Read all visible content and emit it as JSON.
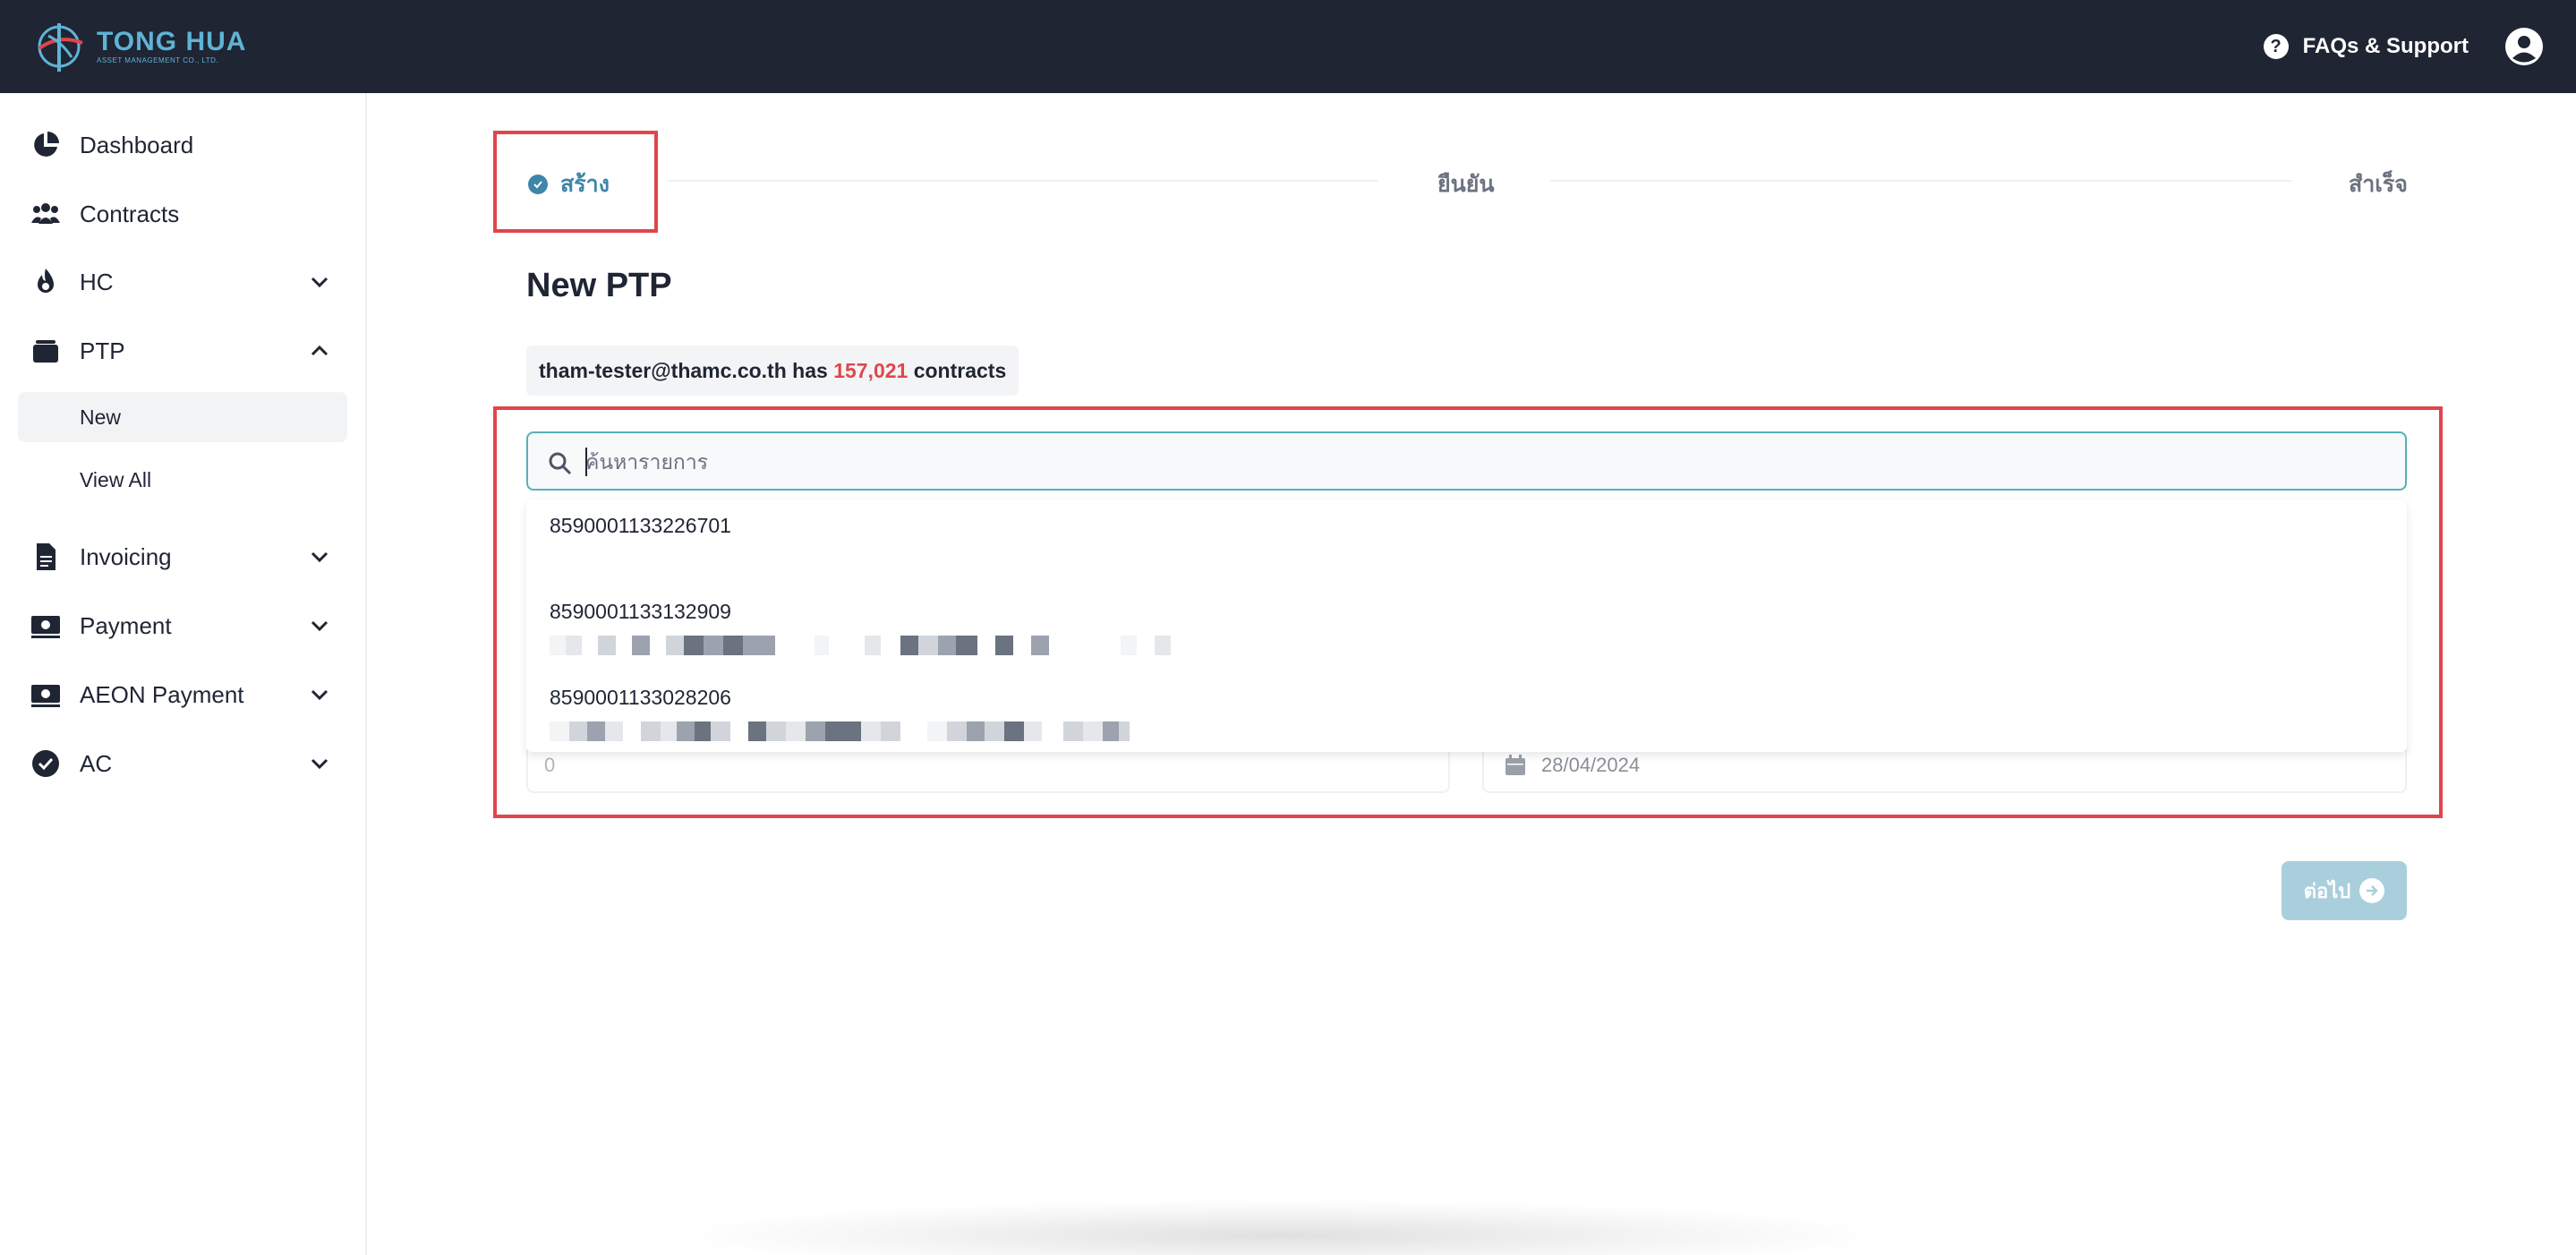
{
  "header": {
    "logo_name": "TONG HUA",
    "logo_sub": "ASSET MANAGEMENT CO., LTD.",
    "faq_label": "FAQs & Support",
    "faq_icon": "question-circle-icon",
    "user_icon": "user-circle-icon",
    "bg_color": "#1f2533"
  },
  "sidebar": {
    "items": [
      {
        "label": "Dashboard",
        "icon": "pie-chart-icon"
      },
      {
        "label": "Contracts",
        "icon": "users-icon"
      },
      {
        "label": "HC",
        "icon": "flame-icon"
      },
      {
        "label": "PTP",
        "icon": "wallet-icon"
      },
      {
        "label": "Invoicing",
        "icon": "file-icon"
      },
      {
        "label": "Payment",
        "icon": "money-bill-icon"
      },
      {
        "label": "AEON Payment",
        "icon": "money-bill-icon"
      },
      {
        "label": "AC",
        "icon": "check-circle-icon"
      }
    ],
    "ptp_sub": [
      {
        "label": "New"
      },
      {
        "label": "View All"
      }
    ]
  },
  "stepper": {
    "step1": "สร้าง",
    "step2": "ยืนยัน",
    "step3": "สำเร็จ",
    "active_color": "#3e86a8"
  },
  "main": {
    "title": "New PTP",
    "summary": {
      "user": "tham-tester@thamc.co.th",
      "has": " has ",
      "count": "157,021",
      "suffix": " contracts"
    },
    "search": {
      "placeholder": "ค้นหารายการ"
    },
    "dropdown": [
      {
        "number": "8590001133226701"
      },
      {
        "number": "8590001133132909"
      },
      {
        "number": "8590001133028206"
      }
    ],
    "amount_value": "0",
    "date_value": "28/04/2024",
    "next_label": "ต่อไป"
  },
  "colors": {
    "highlight_border": "#e0464c",
    "count_color": "#e0464c",
    "input_border": "#58b0b8",
    "button_bg": "#a9cfdd"
  }
}
